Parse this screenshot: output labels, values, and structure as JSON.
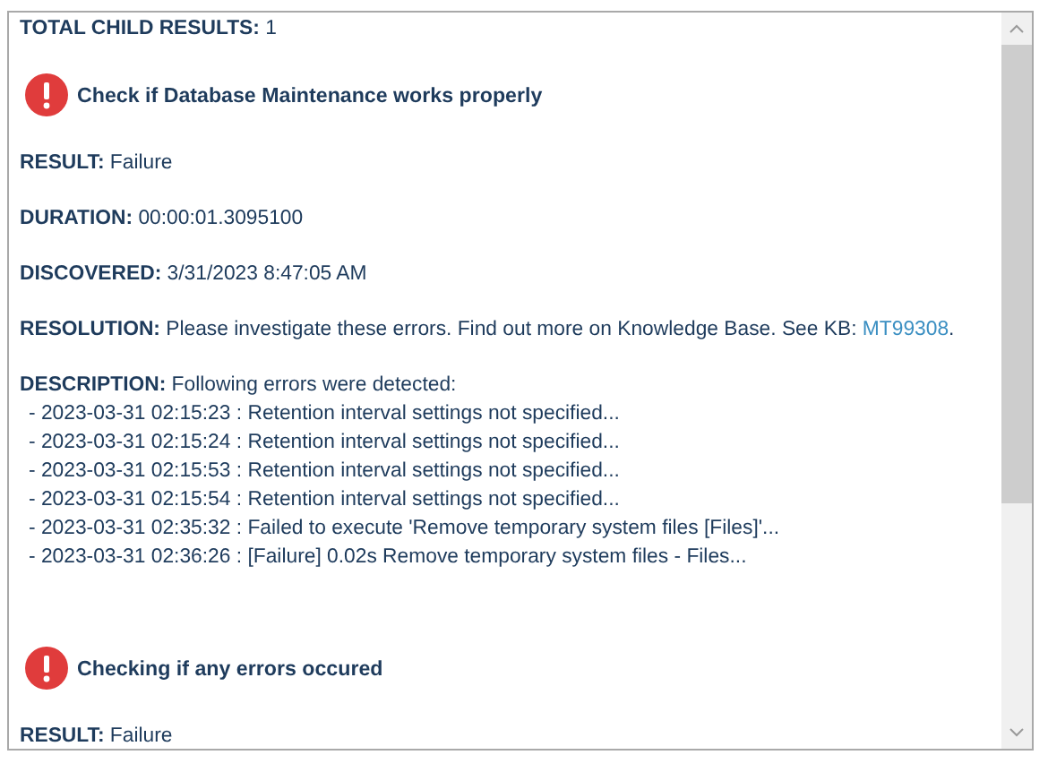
{
  "total_child_results": "**TOTAL CHILD RESULTS:** 1",
  "checks": [
    {
      "kind": "error",
      "title": "Check if Database Maintenance works properly",
      "fields": [
        {
          "text": "**RESULT:** Failure"
        },
        {
          "text": "**DURATION:** 00:00:01.3095100"
        },
        {
          "text": "**DISCOVERED:** 3/31/2023 8:47:05 AM"
        },
        {
          "text": "**RESOLUTION:** Please investigate these errors. Find out more on Knowledge Base. See KB: ",
          "link": "MT99308",
          "after": "."
        },
        {
          "text": "**DESCRIPTION:** Following errors were detected:",
          "lines": [
            "- 2023-03-31 02:15:23 : Retention interval settings not specified...",
            "- 2023-03-31 02:15:24 : Retention interval settings not specified...",
            "- 2023-03-31 02:15:53 : Retention interval settings not specified...",
            "- 2023-03-31 02:15:54 : Retention interval settings not specified...",
            "- 2023-03-31 02:35:32 : Failed to execute 'Remove temporary system files [Files]'...",
            "- 2023-03-31 02:36:26 : [Failure] 0.02s Remove temporary system files - Files..."
          ]
        }
      ]
    },
    {
      "kind": "error",
      "title": "Checking if any errors occured",
      "fields": [
        {
          "text": "**RESULT:** Failure"
        }
      ]
    }
  ]
}
